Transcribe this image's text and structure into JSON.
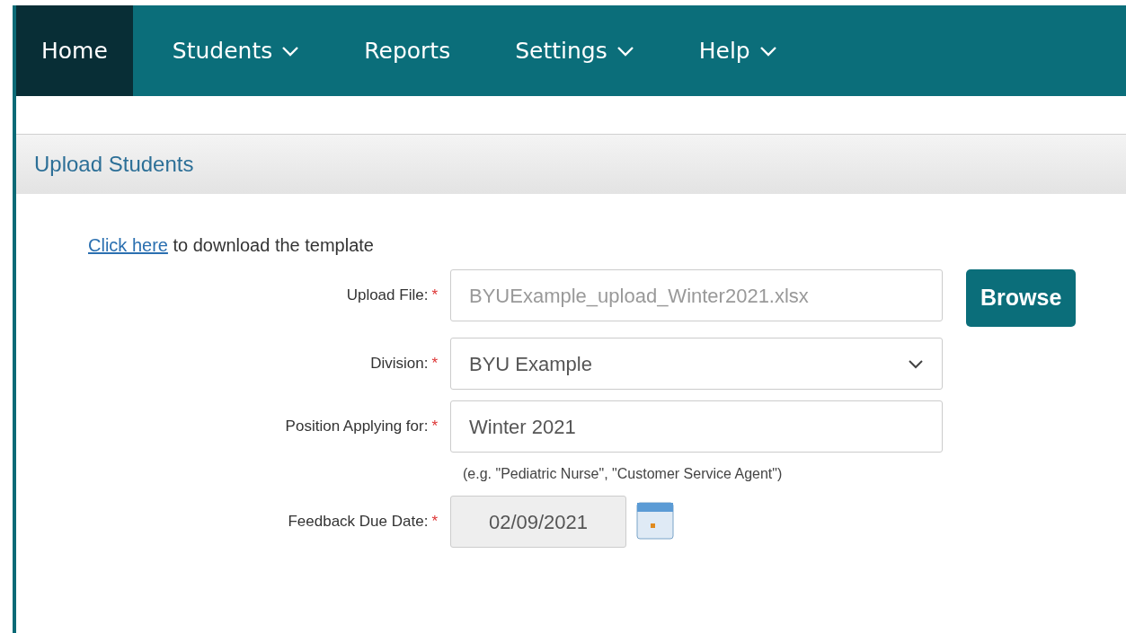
{
  "nav": [
    {
      "label": "Home",
      "selected": true,
      "dropdown": false
    },
    {
      "label": "Students",
      "selected": false,
      "dropdown": true
    },
    {
      "label": "Reports",
      "selected": false,
      "dropdown": false
    },
    {
      "label": "Settings",
      "selected": false,
      "dropdown": true
    },
    {
      "label": "Help",
      "selected": false,
      "dropdown": true
    }
  ],
  "panel": {
    "title": "Upload Students",
    "template_link": {
      "link": "Click here",
      "text": " to download the template"
    },
    "fields": [
      {
        "kind": "file",
        "label": "Upload File:",
        "marker": "*",
        "value": "BYUExample_upload_Winter2021.xlsx",
        "button": "Browse"
      },
      {
        "kind": "select",
        "label": "Division:",
        "marker": "*",
        "value": "BYU Example"
      },
      {
        "kind": "text",
        "label": "Position Applying for:",
        "marker": "*",
        "value": "Winter 2021",
        "help": "(e.g. \"Pediatric Nurse\", \"Customer Service Agent\")"
      },
      {
        "kind": "date",
        "label": "Feedback Due Date:",
        "marker": "*",
        "value": "02/09/2021"
      }
    ]
  }
}
